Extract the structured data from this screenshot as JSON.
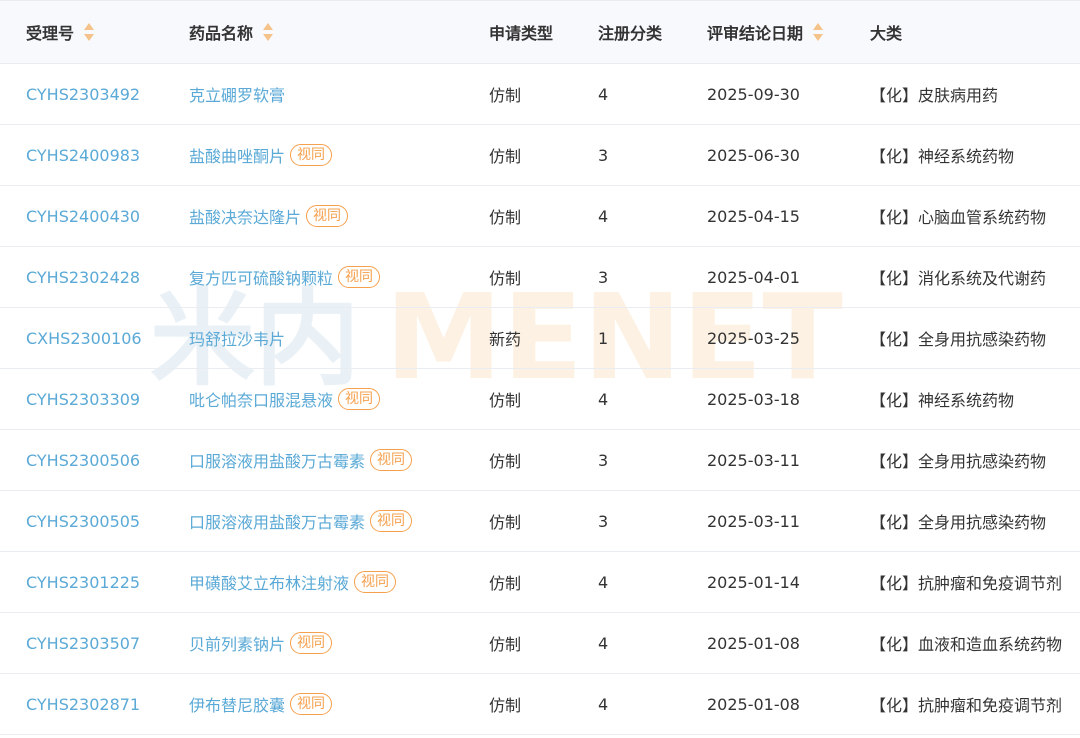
{
  "header": {
    "receipt_no": "受理号",
    "drug_name": "药品名称",
    "application_type": "申请类型",
    "registration_class": "注册分类",
    "review_date": "评审结论日期",
    "category": "大类"
  },
  "watermark": {
    "text_cn": "米内",
    "text_en": "MENET"
  },
  "colors": {
    "link": "#5aa9d6",
    "tag": "#f5a04d",
    "sort_arrow": "#f5c28a",
    "header_bg": "#f7f9fc"
  },
  "rows": [
    {
      "id": "CYHS2303492",
      "name": "克立硼罗软膏",
      "tag": "",
      "type": "仿制",
      "class": "4",
      "date": "2025-09-30",
      "category": "【化】皮肤病用药"
    },
    {
      "id": "CYHS2400983",
      "name": "盐酸曲唑酮片",
      "tag": "视同",
      "type": "仿制",
      "class": "3",
      "date": "2025-06-30",
      "category": "【化】神经系统药物"
    },
    {
      "id": "CYHS2400430",
      "name": "盐酸决奈达隆片",
      "tag": "视同",
      "type": "仿制",
      "class": "4",
      "date": "2025-04-15",
      "category": "【化】心脑血管系统药物"
    },
    {
      "id": "CYHS2302428",
      "name": "复方匹可硫酸钠颗粒",
      "tag": "视同",
      "type": "仿制",
      "class": "3",
      "date": "2025-04-01",
      "category": "【化】消化系统及代谢药"
    },
    {
      "id": "CXHS2300106",
      "name": "玛舒拉沙韦片",
      "tag": "",
      "type": "新药",
      "class": "1",
      "date": "2025-03-25",
      "category": "【化】全身用抗感染药物"
    },
    {
      "id": "CYHS2303309",
      "name": "吡仑帕奈口服混悬液",
      "tag": "视同",
      "type": "仿制",
      "class": "4",
      "date": "2025-03-18",
      "category": "【化】神经系统药物"
    },
    {
      "id": "CYHS2300506",
      "name": "口服溶液用盐酸万古霉素",
      "tag": "视同",
      "type": "仿制",
      "class": "3",
      "date": "2025-03-11",
      "category": "【化】全身用抗感染药物"
    },
    {
      "id": "CYHS2300505",
      "name": "口服溶液用盐酸万古霉素",
      "tag": "视同",
      "type": "仿制",
      "class": "3",
      "date": "2025-03-11",
      "category": "【化】全身用抗感染药物"
    },
    {
      "id": "CYHS2301225",
      "name": "甲磺酸艾立布林注射液",
      "tag": "视同",
      "type": "仿制",
      "class": "4",
      "date": "2025-01-14",
      "category": "【化】抗肿瘤和免疫调节剂"
    },
    {
      "id": "CYHS2303507",
      "name": "贝前列素钠片",
      "tag": "视同",
      "type": "仿制",
      "class": "4",
      "date": "2025-01-08",
      "category": "【化】血液和造血系统药物"
    },
    {
      "id": "CYHS2302871",
      "name": "伊布替尼胶囊",
      "tag": "视同",
      "type": "仿制",
      "class": "4",
      "date": "2025-01-08",
      "category": "【化】抗肿瘤和免疫调节剂"
    }
  ]
}
